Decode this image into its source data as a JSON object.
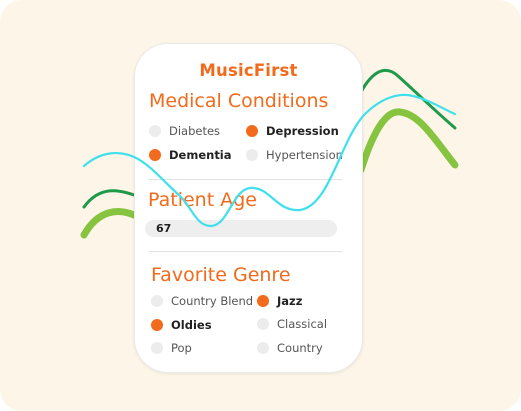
{
  "app": {
    "title": "MusicFirst"
  },
  "conditions": {
    "title": "Medical Conditions",
    "options": [
      {
        "label": "Diabetes",
        "selected": false
      },
      {
        "label": "Depression",
        "selected": true
      },
      {
        "label": "Dementia",
        "selected": true
      },
      {
        "label": "Hypertension",
        "selected": false
      }
    ]
  },
  "age": {
    "title": "Patient Age",
    "value": "67"
  },
  "genre": {
    "title": "Favorite Genre",
    "options": [
      {
        "label": "Country Blend",
        "selected": false
      },
      {
        "label": "Jazz",
        "selected": true
      },
      {
        "label": "Oldies",
        "selected": true
      },
      {
        "label": "Classical",
        "selected": false
      },
      {
        "label": "Pop",
        "selected": false
      },
      {
        "label": "Country",
        "selected": false
      }
    ]
  },
  "colors": {
    "accent": "#f26a1b",
    "wave_cyan": "#3fe0ec",
    "wave_dark_green": "#1f9a4a",
    "wave_light_green": "#86c440",
    "background": "#fdf6e8"
  }
}
